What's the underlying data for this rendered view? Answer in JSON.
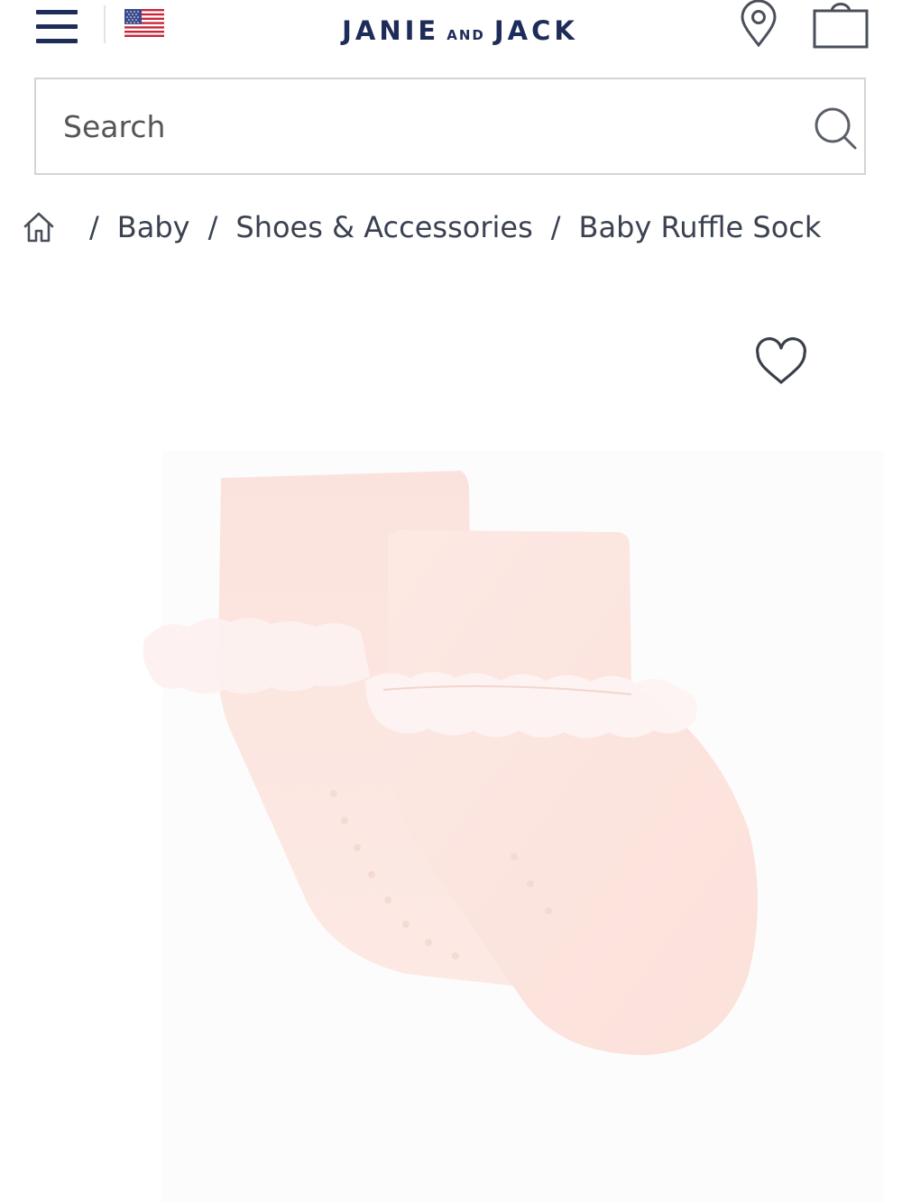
{
  "header": {
    "brand": {
      "main_left": "JANIE",
      "connector": "AND",
      "main_right": "JACK"
    },
    "brand_color": "#1e2c5a",
    "region_flag": "us-flag-icon"
  },
  "search": {
    "placeholder": "Search",
    "value": ""
  },
  "breadcrumb": {
    "home_icon": "home-icon",
    "separator": "/",
    "items": [
      "Baby",
      "Shoes & Accessories",
      "Baby Ruffle Sock"
    ]
  },
  "product": {
    "image_icon": "pink-ruffle-socks-image",
    "favorite_icon": "heart-outline-icon"
  }
}
